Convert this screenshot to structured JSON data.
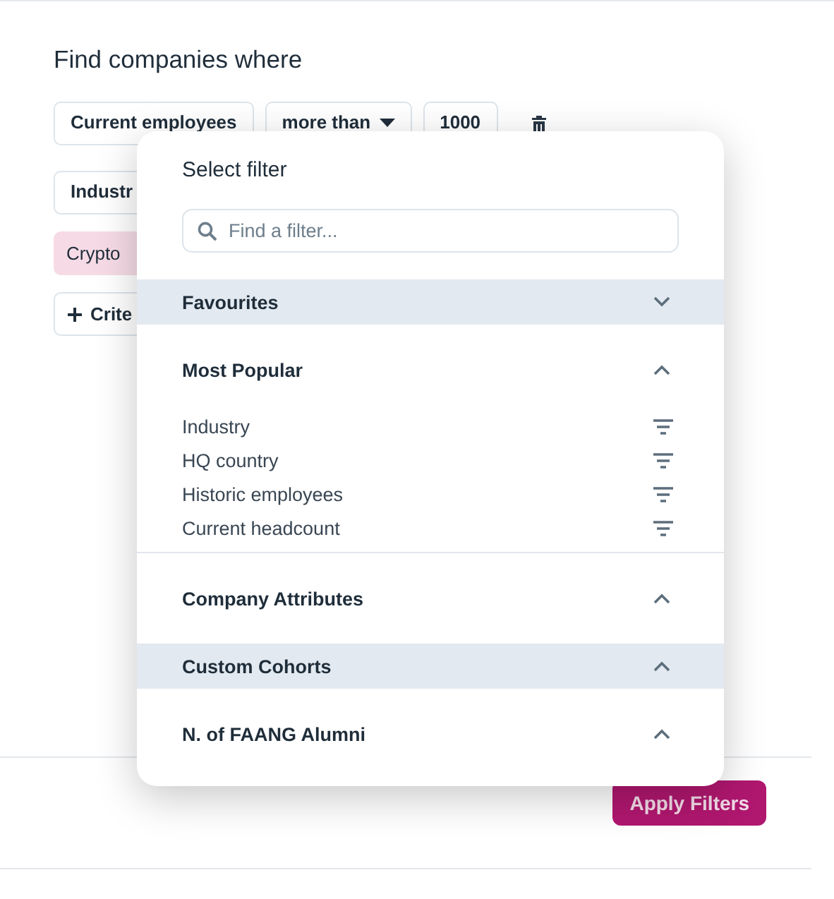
{
  "heading": "Find companies where",
  "criteria": [
    {
      "chips": [
        {
          "kind": "field",
          "label": "Current employees"
        },
        {
          "kind": "dropdown",
          "label": "more than"
        },
        {
          "kind": "field",
          "label": "1000"
        }
      ],
      "deletable": true
    },
    {
      "chips": [
        {
          "kind": "field",
          "label": "Industr"
        }
      ]
    },
    {
      "chips": [
        {
          "kind": "tag",
          "label": "Crypto"
        }
      ]
    },
    {
      "chips": [
        {
          "kind": "add",
          "label": "Crite"
        }
      ]
    }
  ],
  "apply_button": "Apply Filters",
  "popup": {
    "title": "Select filter",
    "search": {
      "placeholder": "Find a filter..."
    },
    "sections": [
      {
        "name": "Favourites",
        "expanded": false,
        "highlighted": true
      },
      {
        "name": "Most Popular",
        "expanded": true,
        "highlighted": false,
        "items": [
          "Industry",
          "HQ country",
          "Historic employees",
          "Current headcount"
        ]
      },
      {
        "name": "Company Attributes",
        "expanded": true,
        "highlighted": false
      },
      {
        "name": "Custom Cohorts",
        "expanded": true,
        "highlighted": true
      },
      {
        "name": "N. of FAANG Alumni",
        "expanded": true,
        "highlighted": false
      }
    ]
  }
}
